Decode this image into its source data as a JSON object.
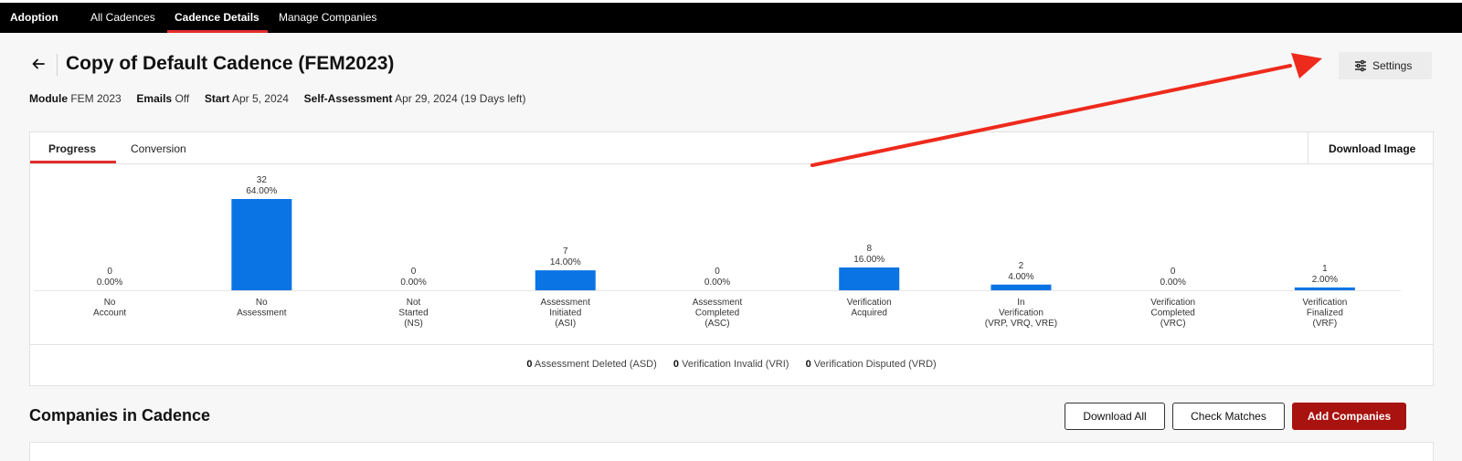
{
  "topbar": {
    "brand": "Adoption",
    "tabs": [
      {
        "label": "All Cadences",
        "active": false
      },
      {
        "label": "Cadence Details",
        "active": true
      },
      {
        "label": "Manage Companies",
        "active": false
      }
    ]
  },
  "header": {
    "title": "Copy of Default Cadence (FEM2023)",
    "settings_label": "Settings"
  },
  "meta": {
    "module_label": "Module",
    "module_value": "FEM 2023",
    "emails_label": "Emails",
    "emails_value": "Off",
    "start_label": "Start",
    "start_value": "Apr 5, 2024",
    "sa_label": "Self-Assessment",
    "sa_value": "Apr 29, 2024 (19 Days left)"
  },
  "card": {
    "tabs": [
      {
        "label": "Progress",
        "active": true
      },
      {
        "label": "Conversion",
        "active": false
      }
    ],
    "download_image_label": "Download Image"
  },
  "chart_data": {
    "type": "bar",
    "categories": [
      [
        "No",
        "Account"
      ],
      [
        "No",
        "Assessment"
      ],
      [
        "Not",
        "Started",
        "(NS)"
      ],
      [
        "Assessment",
        "Initiated",
        "(ASI)"
      ],
      [
        "Assessment",
        "Completed",
        "(ASC)"
      ],
      [
        "Verification",
        "Acquired"
      ],
      [
        "In",
        "Verification",
        "(VRP, VRQ, VRE)"
      ],
      [
        "Verification",
        "Completed",
        "(VRC)"
      ],
      [
        "Verification",
        "Finalized",
        "(VRF)"
      ]
    ],
    "values": [
      0,
      32,
      0,
      7,
      0,
      8,
      2,
      0,
      1
    ],
    "percents": [
      "0.00%",
      "64.00%",
      "0.00%",
      "14.00%",
      "0.00%",
      "16.00%",
      "4.00%",
      "0.00%",
      "2.00%"
    ],
    "ylim": [
      0,
      32
    ],
    "bar_color": "#0b74e5"
  },
  "stats": {
    "deleted_count": "0",
    "deleted_label": "Assessment Deleted (ASD)",
    "invalid_count": "0",
    "invalid_label": "Verification Invalid (VRI)",
    "disputed_count": "0",
    "disputed_label": "Verification Disputed (VRD)"
  },
  "companies": {
    "title": "Companies in Cadence",
    "download_all": "Download All",
    "check_matches": "Check Matches",
    "add_companies": "Add Companies"
  },
  "colors": {
    "accent_red": "#e32d2d",
    "primary_button": "#a8120f",
    "annotation_arrow": "#ee2a1c"
  }
}
